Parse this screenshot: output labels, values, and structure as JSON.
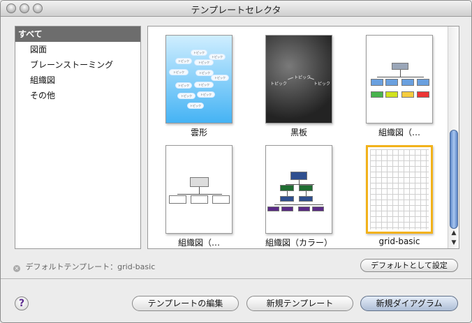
{
  "window": {
    "title": "テンプレートセレクタ"
  },
  "sidebar": {
    "items": [
      {
        "label": "すべて",
        "selected": true
      },
      {
        "label": "図面"
      },
      {
        "label": "ブレーンストーミング"
      },
      {
        "label": "組織図"
      },
      {
        "label": "その他"
      }
    ]
  },
  "gallery": {
    "templates": [
      {
        "label": "雲形",
        "preview": "cloud-bubbles",
        "topic_text": "トピック"
      },
      {
        "label": "黒板",
        "preview": "blackboard",
        "topic_text": "トピック"
      },
      {
        "label": "組織図（…",
        "preview": "org-chart-color-small"
      },
      {
        "label": "組織図（…",
        "preview": "org-chart-plain"
      },
      {
        "label": "組織図（カラー）",
        "preview": "org-chart-color"
      },
      {
        "label": "grid-basic",
        "preview": "grid",
        "selected": true
      }
    ]
  },
  "footer": {
    "default_template_label": "デフォルトテンプレート：grid-basic",
    "set_default_button": "デフォルトとして設定",
    "edit_template_button": "テンプレートの編集",
    "new_template_button": "新規テンプレート",
    "new_diagram_button": "新規ダイアグラム",
    "help_button": "?"
  },
  "colors": {
    "selected_sidebar": "#6d6d6d",
    "selected_template_border": "#f2b21b",
    "scroll_thumb": "#7ea3dd",
    "org_header": "#2f4f8f",
    "org_green": "#1f6d31",
    "org_purple": "#5a2a86"
  }
}
